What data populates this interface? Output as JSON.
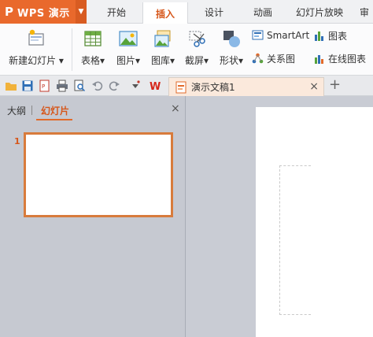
{
  "app": {
    "name": "WPS 演示",
    "logo": "P"
  },
  "menu": {
    "tabs": [
      {
        "label": "开始"
      },
      {
        "label": "插入"
      },
      {
        "label": "设计"
      },
      {
        "label": "动画"
      },
      {
        "label": "幻灯片放映"
      },
      {
        "label": "审"
      }
    ],
    "active": "插入"
  },
  "ribbon": {
    "new_slide": "新建幻灯片",
    "table": "表格",
    "picture": "图片",
    "gallery": "图库",
    "screenshot": "截屏",
    "shape": "形状",
    "smartart": "SmartArt",
    "chart": "图表",
    "relation": "关系图",
    "online_chart": "在线图表",
    "dropdown_arrow": "▾"
  },
  "quickbar": {
    "doc_tab_label": "演示文稿1",
    "close": "×",
    "new_tab": "+"
  },
  "pane": {
    "tab_outline": "大纲",
    "tab_slides": "幻灯片",
    "close": "×",
    "slide_number": "1"
  },
  "colors": {
    "accent": "#e9692c",
    "active_text": "#d6561a"
  }
}
